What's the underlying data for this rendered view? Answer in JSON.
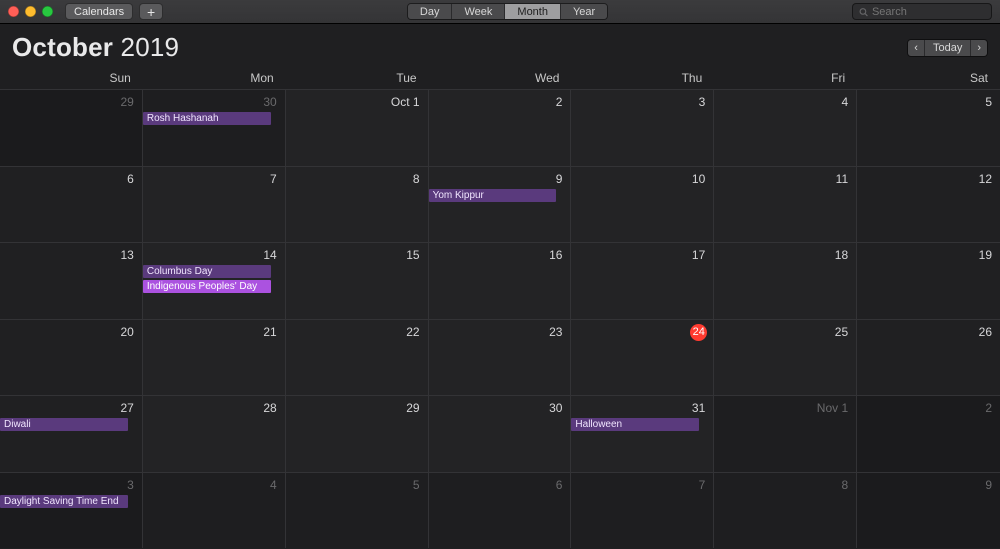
{
  "toolbar": {
    "calendars_label": "Calendars",
    "plus_label": "+",
    "views": {
      "day": "Day",
      "week": "Week",
      "month": "Month",
      "year": "Year",
      "active": "Month"
    },
    "search_placeholder": "Search"
  },
  "header": {
    "month": "October",
    "year": "2019",
    "prev": "‹",
    "today": "Today",
    "next": "›"
  },
  "weekdays": [
    "Sun",
    "Mon",
    "Tue",
    "Wed",
    "Thu",
    "Fri",
    "Sat"
  ],
  "today_index": 25,
  "cells": [
    {
      "label": "29",
      "outside": true,
      "weekend": true,
      "events": []
    },
    {
      "label": "30",
      "outside": true,
      "events": [
        {
          "t": "Rosh Hashanah",
          "c": "dark"
        }
      ]
    },
    {
      "label": "Oct 1",
      "events": []
    },
    {
      "label": "2",
      "events": []
    },
    {
      "label": "3",
      "events": []
    },
    {
      "label": "4",
      "events": []
    },
    {
      "label": "5",
      "weekend": true,
      "events": []
    },
    {
      "label": "6",
      "weekend": true,
      "events": []
    },
    {
      "label": "7",
      "events": []
    },
    {
      "label": "8",
      "events": []
    },
    {
      "label": "9",
      "events": [
        {
          "t": "Yom Kippur",
          "c": "dark"
        }
      ]
    },
    {
      "label": "10",
      "events": []
    },
    {
      "label": "11",
      "events": []
    },
    {
      "label": "12",
      "weekend": true,
      "events": []
    },
    {
      "label": "13",
      "weekend": true,
      "events": []
    },
    {
      "label": "14",
      "events": [
        {
          "t": "Columbus Day",
          "c": "dark"
        },
        {
          "t": "Indigenous Peoples' Day",
          "c": "light"
        }
      ]
    },
    {
      "label": "15",
      "events": []
    },
    {
      "label": "16",
      "events": []
    },
    {
      "label": "17",
      "events": []
    },
    {
      "label": "18",
      "events": []
    },
    {
      "label": "19",
      "weekend": true,
      "events": []
    },
    {
      "label": "20",
      "weekend": true,
      "events": []
    },
    {
      "label": "21",
      "events": []
    },
    {
      "label": "22",
      "events": []
    },
    {
      "label": "23",
      "events": []
    },
    {
      "label": "24",
      "events": []
    },
    {
      "label": "25",
      "events": []
    },
    {
      "label": "26",
      "weekend": true,
      "events": []
    },
    {
      "label": "27",
      "weekend": true,
      "events": [
        {
          "t": "Diwali",
          "c": "dark"
        }
      ]
    },
    {
      "label": "28",
      "events": []
    },
    {
      "label": "29",
      "events": []
    },
    {
      "label": "30",
      "events": []
    },
    {
      "label": "31",
      "events": [
        {
          "t": "Halloween",
          "c": "dark"
        }
      ]
    },
    {
      "label": "Nov 1",
      "outside": true,
      "events": []
    },
    {
      "label": "2",
      "outside": true,
      "weekend": true,
      "events": []
    },
    {
      "label": "3",
      "outside": true,
      "weekend": true,
      "events": [
        {
          "t": "Daylight Saving Time End",
          "c": "dark"
        }
      ]
    },
    {
      "label": "4",
      "outside": true,
      "events": []
    },
    {
      "label": "5",
      "outside": true,
      "events": []
    },
    {
      "label": "6",
      "outside": true,
      "events": []
    },
    {
      "label": "7",
      "outside": true,
      "events": []
    },
    {
      "label": "8",
      "outside": true,
      "events": []
    },
    {
      "label": "9",
      "outside": true,
      "weekend": true,
      "events": []
    }
  ]
}
